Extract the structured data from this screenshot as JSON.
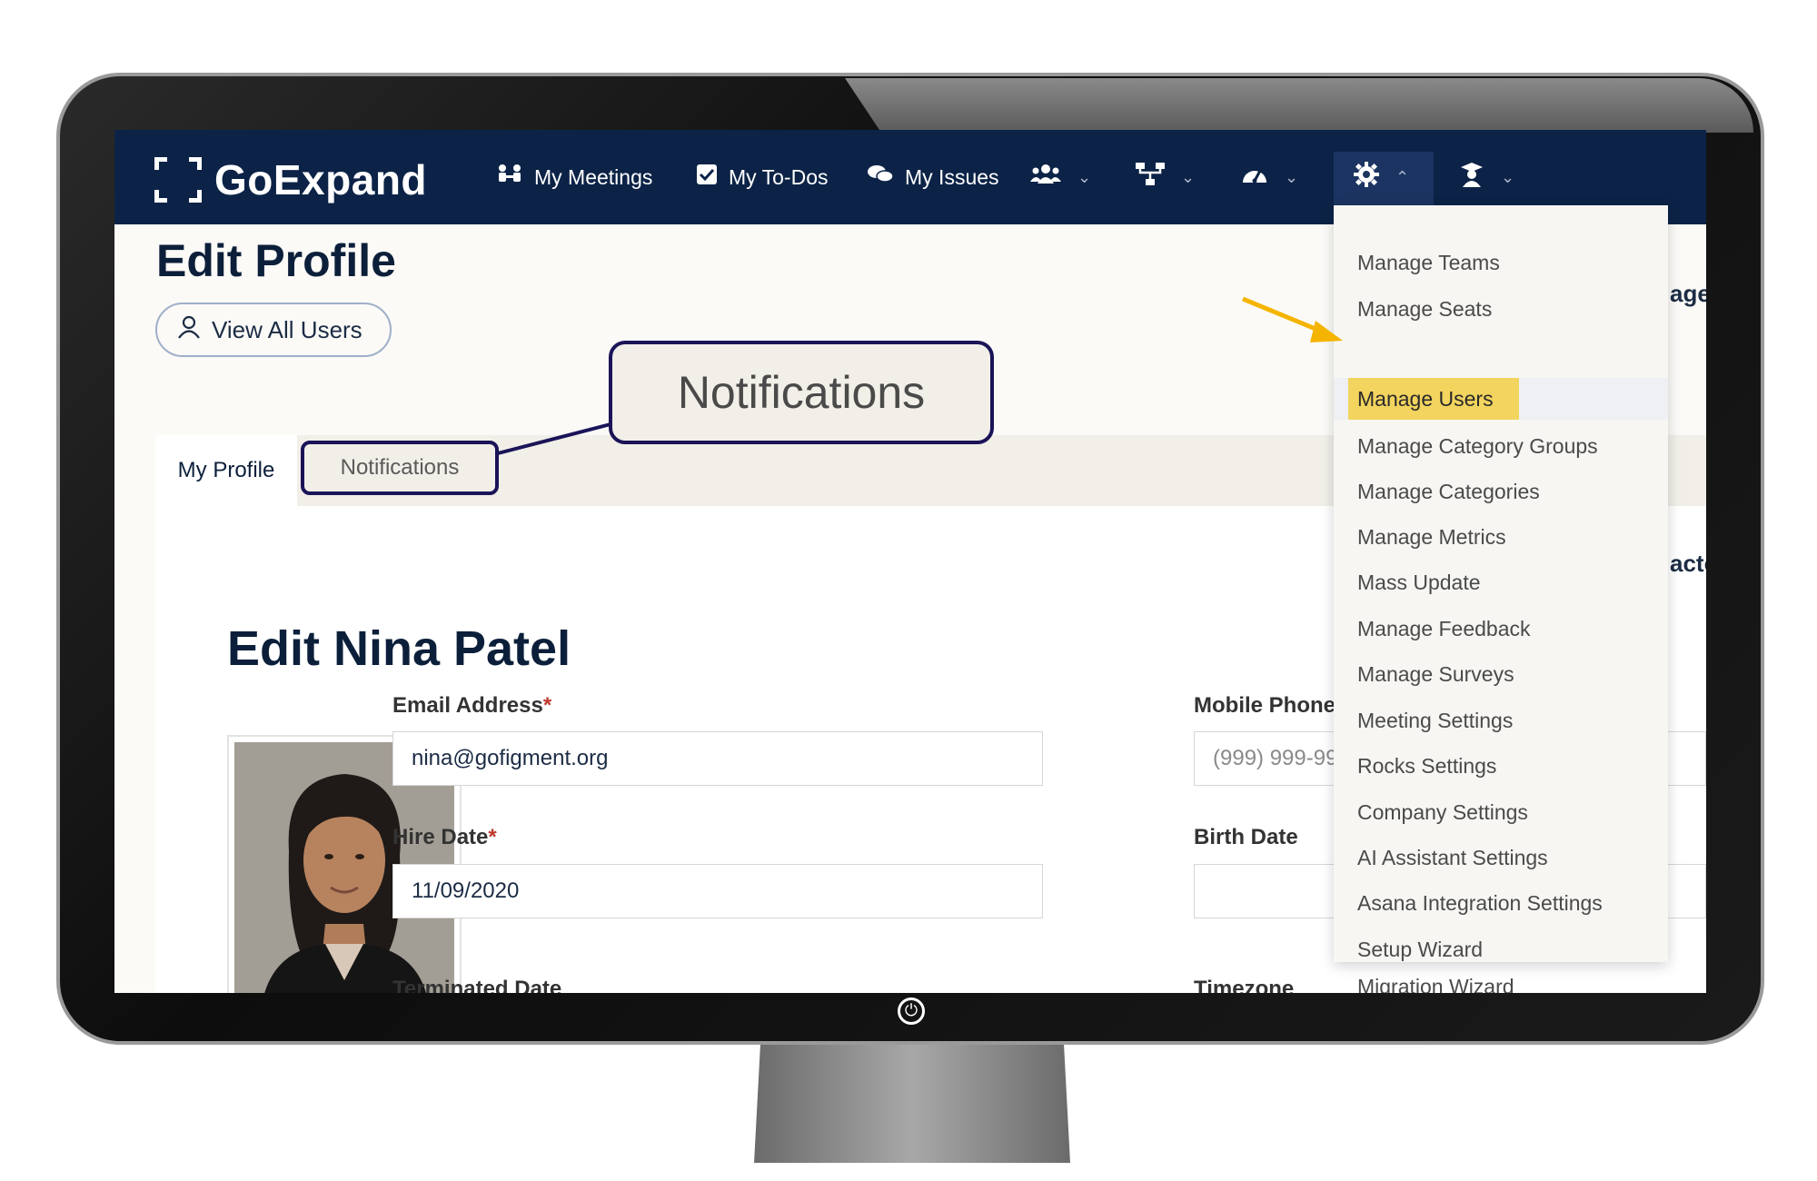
{
  "app": {
    "logo_text": "GoExpand",
    "page_title": "Edit Profile",
    "view_all_users": "View All Users"
  },
  "nav": {
    "items": [
      {
        "label": "My Meetings",
        "icon": "meetings-icon"
      },
      {
        "label": "My To-Dos",
        "icon": "checkbox-icon"
      },
      {
        "label": "My Issues",
        "icon": "chat-bubbles-icon"
      }
    ],
    "icon_menus": [
      "users-icon",
      "org-chart-icon",
      "dashboard-gauge-icon",
      "gear-icon",
      "graduate-icon"
    ]
  },
  "tabs": {
    "my_profile": "My Profile",
    "notifications": "Notifications"
  },
  "callout": {
    "text": "Notifications"
  },
  "profile": {
    "title": "Edit Nina Patel",
    "email_label": "Email Address",
    "email_value": "nina@gofigment.org",
    "mobile_label": "Mobile Phone",
    "mobile_placeholder": "(999) 999-99",
    "hire_label": "Hire Date",
    "hire_value": "11/09/2020",
    "birth_label": "Birth Date",
    "terminated_label": "Terminated Date",
    "timezone_label": "Timezone",
    "required_mark": "*"
  },
  "edge_text": {
    "top": "age",
    "mid": "acto"
  },
  "dropdown": {
    "items": [
      "Manage Teams",
      "Manage Seats",
      "Manage Users",
      "Manage Category Groups",
      "Manage Categories",
      "Manage Metrics",
      "Mass Update",
      "Manage Feedback",
      "Manage Surveys",
      "Meeting Settings",
      "Rocks Settings",
      "Company Settings",
      "AI Assistant Settings",
      "Asana Integration Settings",
      "Setup Wizard",
      "Migration Wizard"
    ],
    "highlighted_index": 2
  },
  "colors": {
    "nav_bg": "#0c2347",
    "highlight": "#f2d45e",
    "arrow": "#f5b400",
    "callout_border": "#1a1458"
  }
}
